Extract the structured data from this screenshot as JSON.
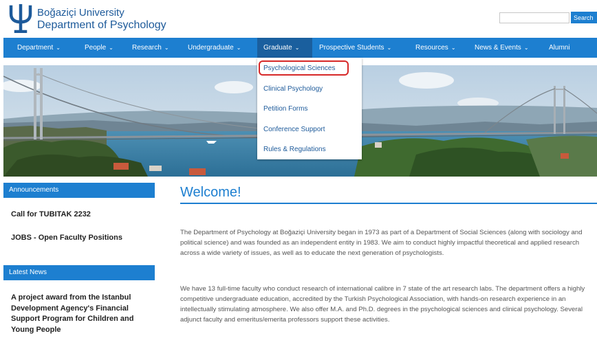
{
  "header": {
    "university": "Boğaziçi University",
    "department": "Department of Psychology",
    "search_placeholder": "",
    "search_label": "Search"
  },
  "nav": {
    "items": [
      {
        "label": "Department",
        "has_caret": true
      },
      {
        "label": "People",
        "has_caret": true
      },
      {
        "label": "Research",
        "has_caret": true
      },
      {
        "label": "Undergraduate",
        "has_caret": true
      },
      {
        "label": "Graduate",
        "has_caret": true,
        "active": true
      },
      {
        "label": "Prospective Students",
        "has_caret": true
      },
      {
        "label": "Resources",
        "has_caret": true
      },
      {
        "label": "News & Events",
        "has_caret": true
      },
      {
        "label": "Alumni",
        "has_caret": false
      }
    ],
    "caret": "⌄"
  },
  "graduate_menu": {
    "items": [
      "Psychological Sciences",
      "Clinical Psychology",
      "Petition Forms",
      "Conference Support",
      "Rules & Regulations"
    ],
    "highlighted": "Psychological Sciences"
  },
  "sidebar": {
    "announcements_title": "Announcements",
    "announcements": [
      "Call for TUBITAK 2232",
      "JOBS - Open Faculty Positions"
    ],
    "news_title": "Latest News",
    "news": [
      "A project award from the Istanbul Development Agency's Financial Support Program for Children and Young People"
    ]
  },
  "main": {
    "title": "Welcome!",
    "paragraph1": "The Department of Psychology at Boğaziçi University began in 1973 as part of a Department of Social Sciences (along with sociology and political science) and was founded as an independent entity in 1983. We aim to conduct highly impactful theoretical and applied research across a wide variety of issues, as well as to educate the next generation of psychologists.",
    "paragraph2": "We have 13 full-time faculty who conduct research of international calibre in 7 state of the art research labs. The department offers a highly competitive undergraduate education, accredited by the Turkish Psychological Association, with hands-on research experience in an intellectually stimulating atmosphere. We also offer M.A. and Ph.D. degrees in the psychological sciences and clinical psychology. Several adjunct faculty and emeritus/emerita professors support these activities."
  },
  "colors": {
    "brand_blue": "#1d7fd0",
    "active_nav": "#1a5f9e",
    "highlight_red": "#d62828"
  }
}
